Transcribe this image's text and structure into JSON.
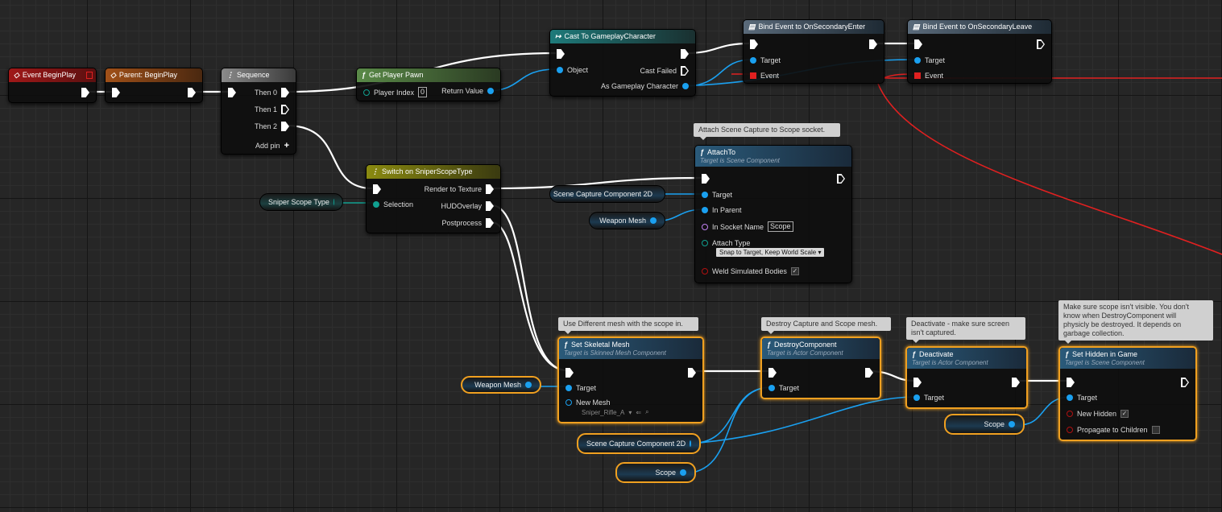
{
  "colors": {
    "exec_wire": "#ffffff",
    "object_wire": "#1aa0f0",
    "enum_wire": "#10a090",
    "delegate_wire": "#e02020",
    "selection": "#f0a020"
  },
  "nodes": {
    "event_begin_play": {
      "title": "Event BeginPlay",
      "icon": "event-diamond-icon"
    },
    "parent_begin_play": {
      "title": "Parent: BeginPlay",
      "icon": "event-diamond-icon"
    },
    "sequence": {
      "title": "Sequence",
      "pins": [
        "Then 0",
        "Then 1",
        "Then 2"
      ],
      "add_pin": "Add pin",
      "add_icon": "+"
    },
    "get_player_pawn": {
      "title": "Get Player Pawn",
      "player_index_label": "Player Index",
      "player_index_value": "0",
      "return_label": "Return Value"
    },
    "cast": {
      "title": "Cast To GameplayCharacter",
      "object": "Object",
      "cast_failed": "Cast Failed",
      "as_char": "As Gameplay Character"
    },
    "bind_enter": {
      "title": "Bind Event to OnSecondaryEnter",
      "target": "Target",
      "event": "Event"
    },
    "bind_leave": {
      "title": "Bind Event to OnSecondaryLeave",
      "target": "Target",
      "event": "Event"
    },
    "switch": {
      "title": "Switch on SniperScopeType",
      "selection": "Selection",
      "outputs": [
        "Render to Texture",
        "HUDOverlay",
        "Postprocess"
      ]
    },
    "attach_to": {
      "comment": "Attach Scene Capture to Scope socket.",
      "title": "AttachTo",
      "subtitle": "Target is Scene Component",
      "target": "Target",
      "in_parent": "In Parent",
      "socket_label": "In Socket Name",
      "socket_value": "Scope",
      "attach_type_label": "Attach Type",
      "attach_type_value": "Snap to Target, Keep World Scale",
      "weld_label": "Weld Simulated Bodies",
      "weld_checked": true
    },
    "set_skeletal_mesh": {
      "comment": "Use Different mesh with the scope in.",
      "title": "Set Skeletal Mesh",
      "subtitle": "Target is Skinned Mesh Component",
      "target": "Target",
      "new_mesh_label": "New Mesh",
      "new_mesh_value": "Sniper_Rifle_A"
    },
    "destroy_component": {
      "comment": "Destroy Capture and Scope mesh.",
      "title": "DestroyComponent",
      "subtitle": "Target is Actor Component",
      "target": "Target"
    },
    "deactivate": {
      "comment": "Deactivate - make sure screen isn't captured.",
      "title": "Deactivate",
      "subtitle": "Target is Actor Component",
      "target": "Target"
    },
    "set_hidden": {
      "comment": "Make sure scope isn't visible. You don't know when DestroyComponent will physicly be destroyed. It depends on garbage collection.",
      "title": "Set Hidden in Game",
      "subtitle": "Target is Scene Component",
      "target": "Target",
      "new_hidden_label": "New Hidden",
      "new_hidden_checked": true,
      "propagate_label": "Propagate to Children",
      "propagate_checked": false
    }
  },
  "variables": {
    "sniper_scope_type": "Sniper Scope Type",
    "scene_capture_1": "Scene Capture Component 2D",
    "weapon_mesh_1": "Weapon Mesh",
    "weapon_mesh_2": "Weapon Mesh",
    "scene_capture_2": "Scene Capture Component 2D",
    "scope_1": "Scope",
    "scope_2": "Scope"
  }
}
